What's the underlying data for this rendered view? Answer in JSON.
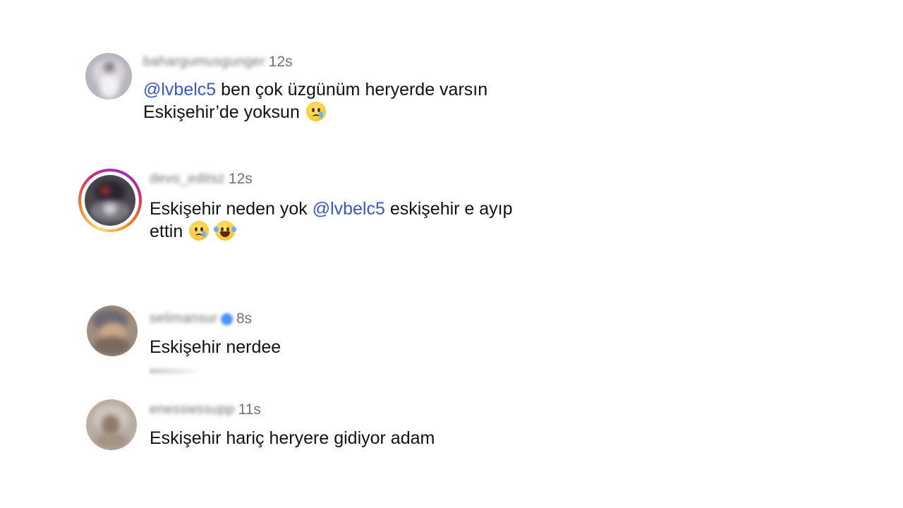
{
  "comments": [
    {
      "username": "bahargumusgunger",
      "time": "12s",
      "mention": "@lvbelc5",
      "text_after_mention": " ben çok üzgünüm heryerde varsın",
      "line2": "Eskişehir’de yoksun",
      "emojis": [
        "crying-face"
      ]
    },
    {
      "username": "devo_editsz",
      "time": "12s",
      "text_before_mention": "Eskişehir neden yok ",
      "mention": "@lvbelc5",
      "text_after_mention": "  eskişehir e ayıp",
      "line2": "ettin",
      "emojis": [
        "crying-face",
        "tears-of-joy"
      ]
    },
    {
      "username": "selimansur",
      "verified": true,
      "time": "8s",
      "text": "Eskişehir nerdee"
    },
    {
      "username": "enesswssupp",
      "time": "11s",
      "text": "Eskişehir hariç heryere gidiyor adam"
    }
  ],
  "colors": {
    "mention": "#3a57c9",
    "timestamp": "#737373",
    "verified": "#4a90ff",
    "story_ring": [
      "#feda75",
      "#fa7e1e",
      "#d62976",
      "#962fbf"
    ]
  }
}
